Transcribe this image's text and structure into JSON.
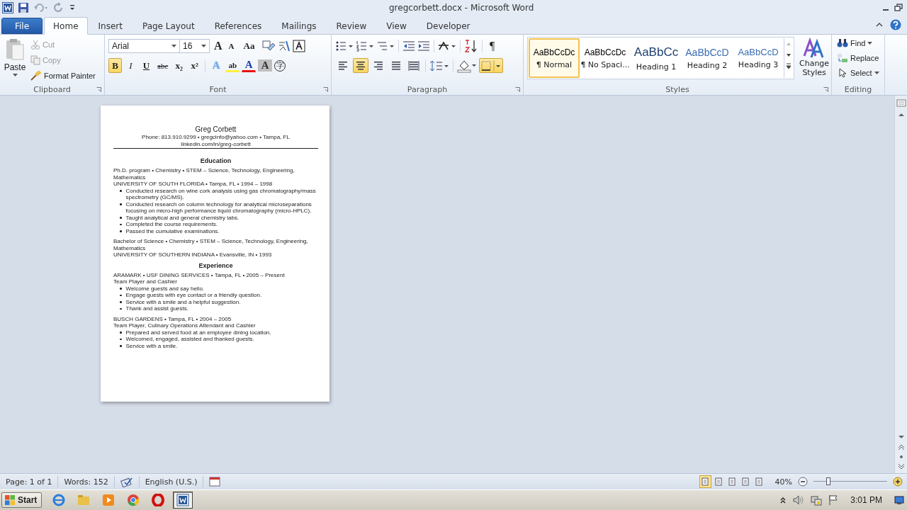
{
  "window": {
    "title": "gregcorbett.docx - Microsoft Word"
  },
  "tabs": [
    {
      "label": "File",
      "kind": "file",
      "selected": false
    },
    {
      "label": "Home",
      "kind": "tab",
      "selected": true
    },
    {
      "label": "Insert",
      "kind": "tab",
      "selected": false
    },
    {
      "label": "Page Layout",
      "kind": "tab",
      "selected": false
    },
    {
      "label": "References",
      "kind": "tab",
      "selected": false
    },
    {
      "label": "Mailings",
      "kind": "tab",
      "selected": false
    },
    {
      "label": "Review",
      "kind": "tab",
      "selected": false
    },
    {
      "label": "View",
      "kind": "tab",
      "selected": false
    },
    {
      "label": "Developer",
      "kind": "tab",
      "selected": false
    }
  ],
  "clipboard": {
    "label": "Clipboard",
    "paste": "Paste",
    "cut": {
      "label": "Cut",
      "disabled": true
    },
    "copy": {
      "label": "Copy",
      "disabled": true
    },
    "format_painter": "Format Painter"
  },
  "font": {
    "label": "Font",
    "family": "Arial",
    "size": "16",
    "grow": "A",
    "shrink": "A",
    "change_case": "Aa",
    "format": [
      {
        "label": "B",
        "kind": "bold",
        "selected": true
      },
      {
        "label": "I",
        "kind": "italic",
        "selected": false
      },
      {
        "label": "U",
        "kind": "underline",
        "selected": false
      },
      {
        "label": "abc",
        "kind": "strike",
        "selected": false
      },
      {
        "label": "x₂",
        "kind": "sub",
        "selected": false
      },
      {
        "label": "x²",
        "kind": "sup",
        "selected": false
      }
    ],
    "tools": [
      {
        "label": "A",
        "kind": "effects"
      },
      {
        "label": "ab",
        "kind": "highlight"
      },
      {
        "label": "A",
        "kind": "color"
      },
      {
        "label": "A",
        "kind": "shade"
      },
      {
        "label": "字",
        "kind": "enclose"
      }
    ]
  },
  "paragraph": {
    "label": "Paragraph",
    "show_marks": "¶",
    "align": [
      {
        "kind": "left",
        "selected": false
      },
      {
        "kind": "center",
        "selected": true
      },
      {
        "kind": "right",
        "selected": false
      },
      {
        "kind": "justify",
        "selected": false
      },
      {
        "kind": "distributed",
        "selected": false
      }
    ],
    "borders": {
      "selected": true
    }
  },
  "styles": {
    "label": "Styles",
    "change_styles": "Change Styles",
    "items": [
      {
        "preview": "AaBbCcDc",
        "name": "¶ Normal",
        "kind": "normal",
        "selected": true
      },
      {
        "preview": "AaBbCcDc",
        "name": "¶ No Spaci...",
        "kind": "normal",
        "selected": false
      },
      {
        "preview": "AaBbCc",
        "name": "Heading 1",
        "kind": "heading1",
        "selected": false
      },
      {
        "preview": "AaBbCcD",
        "name": "Heading 2",
        "kind": "heading2",
        "selected": false
      },
      {
        "preview": "AaBbCcD",
        "name": "Heading 3",
        "kind": "heading3",
        "selected": false
      }
    ]
  },
  "editing": {
    "label": "Editing",
    "find": "Find",
    "replace": "Replace",
    "select": "Select"
  },
  "document": {
    "name": "Greg Corbett",
    "contact": "Phone: 813.910.9299 • gregcinfo@yahoo.com • Tampa, FL",
    "link": "linkedin.com/in/greg-corbett",
    "sections": [
      {
        "heading": "Education",
        "entries": [
          {
            "lines": [
              "Ph.D. program • Chemistry • STEM – Science, Technology, Engineering, Mathematics",
              "UNIVERSITY OF SOUTH FLORIDA • Tampa, FL • 1994 – 1998"
            ],
            "bullets": [
              "Conducted research on wine cork analysis using gas chromatography/mass spectrometry (GC/MS).",
              "Conducted research on column technology for analytical microseparations focusing on micro-high performance liquid chromatography (micro-HPLC).",
              "Taught analytical and general chemistry labs.",
              "Completed the course requirements.",
              "Passed the cumulative examinations."
            ]
          },
          {
            "lines": [
              "Bachelor of Science • Chemistry • STEM – Science, Technology, Engineering, Mathematics",
              "UNIVERSITY OF SOUTHERN INDIANA • Evansville, IN • 1993"
            ]
          }
        ]
      },
      {
        "heading": "Experience",
        "entries": [
          {
            "lines": [
              "ARAMARK • USF DINING SERVICES • Tampa, FL • 2005 – Present",
              "Team Player and Cashier"
            ],
            "bullets": [
              "Welcome guests and say hello.",
              "Engage guests with eye contact or a friendly question.",
              "Service with a smile and a helpful suggestion.",
              "Thank and assist guests."
            ]
          },
          {
            "lines": [
              "BUSCH GARDENS • Tampa, FL • 2004 – 2005",
              "Team Player, Culinary Operations Attendant and Cashier"
            ],
            "bullets": [
              "Prepared and served food at an employee dining location.",
              "Welcomed, engaged, assisted and thanked guests.",
              "Service with a smile."
            ]
          }
        ]
      }
    ]
  },
  "status_bar": {
    "page": "Page: 1 of 1",
    "words": "Words: 152",
    "language": "English (U.S.)",
    "zoom": "40%",
    "zoom_slider": {
      "level": 0.2
    },
    "views": [
      {
        "selected": true
      },
      {
        "selected": false
      },
      {
        "selected": false
      },
      {
        "selected": false
      },
      {
        "selected": false
      }
    ]
  },
  "taskbar": {
    "start": "Start",
    "apps": [
      {
        "kind": "ie",
        "selected": false
      },
      {
        "kind": "folder",
        "selected": false
      },
      {
        "kind": "media",
        "selected": false
      },
      {
        "kind": "chrome",
        "selected": false
      },
      {
        "kind": "opera",
        "selected": false
      },
      {
        "kind": "word",
        "selected": true
      }
    ],
    "clock": "3:01 PM"
  }
}
